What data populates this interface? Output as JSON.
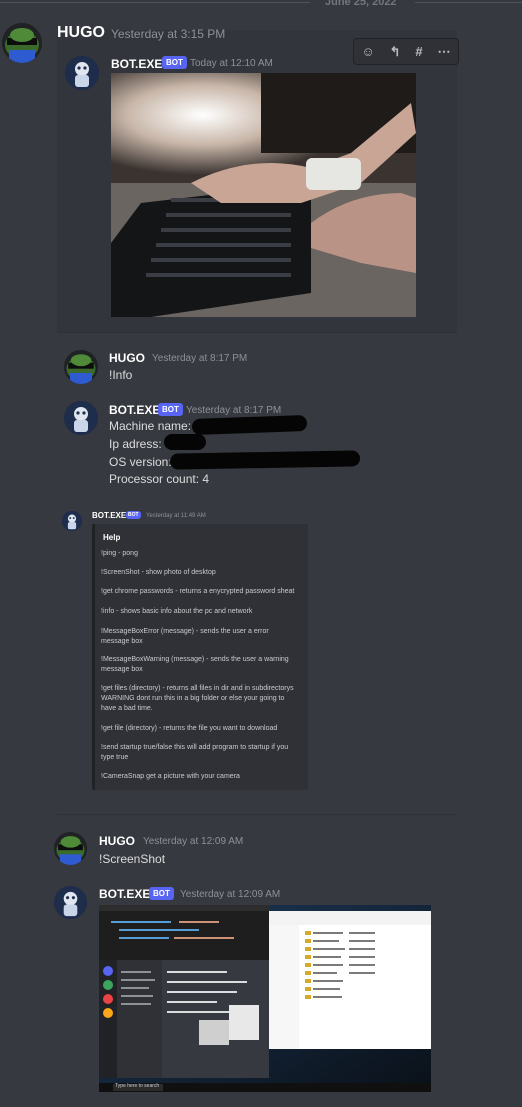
{
  "date_divider": "June 25, 2022",
  "toolbar": {
    "icons": [
      "add-reaction-icon",
      "reply-icon",
      "create-thread-icon",
      "more-icon"
    ],
    "glyphs": {
      "react": "☺",
      "reply": "↰",
      "thread": "#",
      "more": "⋯"
    }
  },
  "bot_tag": "BOT",
  "group1": {
    "user": {
      "name": "HUGO",
      "timestamp": "Yesterday at 3:15 PM"
    },
    "bot": {
      "name": "BOT.EXE",
      "timestamp": "Today at 12:10 AM"
    },
    "image": {
      "description": "webcam photo of hands on keyboard"
    }
  },
  "group2": {
    "user": {
      "name": "HUGO",
      "timestamp": "Yesterday at 8:17 PM",
      "message": "!Info"
    },
    "bot": {
      "name": "BOT.EXE",
      "timestamp": "Yesterday at 8:17 PM",
      "lines": [
        "Machine name:",
        "Ip adress:",
        "OS version:",
        "Processor count: 4"
      ]
    }
  },
  "group3": {
    "bot": {
      "name": "BOT.EXE",
      "timestamp": "Yesterday at 11:49 AM"
    },
    "embed": {
      "title": "Help",
      "items": [
        "!ping - pong",
        "!ScreenShot - show photo of desktop",
        "!get chrome passwords - returns a enycrypted password sheat",
        "!info - shows basic info about the pc and network",
        "!MessageBoxError (message) - sends the user a error message box",
        "!MessageBoxWarning (message) - sends the user a warning message box",
        "!get files (directory) - returns all files in dir and in subdirectorys WARNING dont run this in a big folder or else your going to have a bad time.",
        "!get file (directory) - returns the file you want to download",
        "!send startup true/false this will add program to startup if you type true",
        "!CameraSnap get a picture with your camera"
      ]
    }
  },
  "group4": {
    "user": {
      "name": "HUGO",
      "timestamp": "Yesterday at 12:09 AM",
      "message": "!ScreenShot"
    },
    "bot": {
      "name": "BOT.EXE",
      "timestamp": "Yesterday at 12:09 AM"
    },
    "screenshot": {
      "taskbar_search": "Type here to search"
    }
  }
}
